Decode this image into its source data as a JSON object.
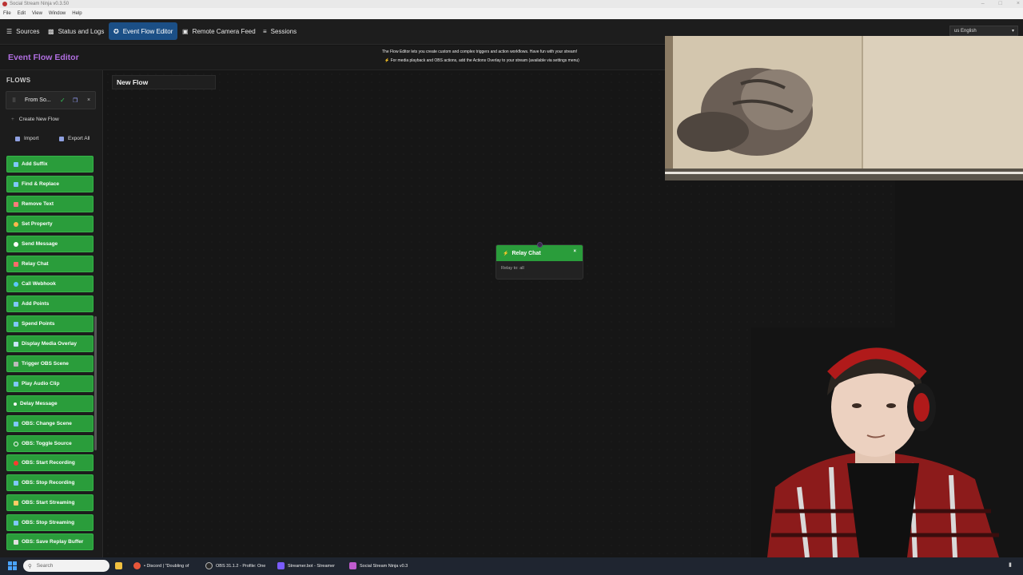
{
  "window": {
    "title": "Social Stream Ninja v0.3.50",
    "controls": [
      "minimize",
      "maximize",
      "close"
    ]
  },
  "menubar": {
    "items": [
      "File",
      "Edit",
      "View",
      "Window",
      "Help"
    ]
  },
  "navbar": {
    "tabs": [
      {
        "label": "Sources",
        "icon": "sliders-icon",
        "active": false
      },
      {
        "label": "Status and Logs",
        "icon": "monitor-icon",
        "active": false
      },
      {
        "label": "Event Flow Editor",
        "icon": "flow-icon",
        "active": true
      },
      {
        "label": "Remote Camera Feed",
        "icon": "camera-icon",
        "active": false
      },
      {
        "label": "Sessions",
        "icon": "sessions-icon",
        "active": false
      }
    ],
    "language": "us English"
  },
  "editor": {
    "title": "Event Flow Editor",
    "info_line1": "The Flow Editor lets you create custom and complex triggers and action workflows. Have fun with your stream!",
    "info_line2": "For media playback and OBS actions, add the Actions Overlay to your stream (available via settings menu)"
  },
  "sidebar": {
    "flows_label": "FLOWS",
    "flows": [
      {
        "name": "From So...",
        "enabled": true
      }
    ],
    "create_label": "Create New Flow",
    "import_label": "Import",
    "export_label": "Export All",
    "actions": [
      {
        "label": "Add Suffix",
        "icon": "text-icon"
      },
      {
        "label": "Find & Replace",
        "icon": "search-replace-icon"
      },
      {
        "label": "Remove Text",
        "icon": "scissors-icon"
      },
      {
        "label": "Set Property",
        "icon": "palette-icon"
      },
      {
        "label": "Send Message",
        "icon": "chat-icon"
      },
      {
        "label": "Relay Chat",
        "icon": "relay-icon"
      },
      {
        "label": "Call Webhook",
        "icon": "globe-icon"
      },
      {
        "label": "Add Points",
        "icon": "plus-icon"
      },
      {
        "label": "Spend Points",
        "icon": "minus-icon"
      },
      {
        "label": "Display Media Overlay",
        "icon": "image-icon"
      },
      {
        "label": "Trigger OBS Scene",
        "icon": "film-icon"
      },
      {
        "label": "Play Audio Clip",
        "icon": "speaker-icon"
      },
      {
        "label": "Delay Message",
        "icon": "clock-icon"
      },
      {
        "label": "OBS: Change Scene",
        "icon": "film-icon"
      },
      {
        "label": "OBS: Toggle Source",
        "icon": "eye-icon"
      },
      {
        "label": "OBS: Start Recording",
        "icon": "record-icon"
      },
      {
        "label": "OBS: Stop Recording",
        "icon": "stop-icon"
      },
      {
        "label": "OBS: Start Streaming",
        "icon": "broadcast-icon"
      },
      {
        "label": "OBS: Stop Streaming",
        "icon": "stop-icon"
      },
      {
        "label": "OBS: Save Replay Buffer",
        "icon": "replay-icon"
      }
    ]
  },
  "canvas": {
    "flow_name": "New Flow",
    "node": {
      "title": "Relay Chat",
      "body": "Relay to: all"
    }
  },
  "taskbar": {
    "search_placeholder": "Search",
    "apps": [
      {
        "label": "• Discord | \"Doubling of",
        "icon": "browser-icon"
      },
      {
        "label": "OBS 31.1.2 - Profile: One",
        "icon": "obs-icon"
      },
      {
        "label": "Streamer.bot - Streamer",
        "icon": "streamerbot-icon"
      },
      {
        "label": "Social Stream Ninja v0.3",
        "icon": "ssn-icon"
      }
    ]
  },
  "colors": {
    "accent_purple": "#b06ee0",
    "active_tab": "#1b4f86",
    "action_green": "#2a9d3b",
    "background": "#141414"
  }
}
